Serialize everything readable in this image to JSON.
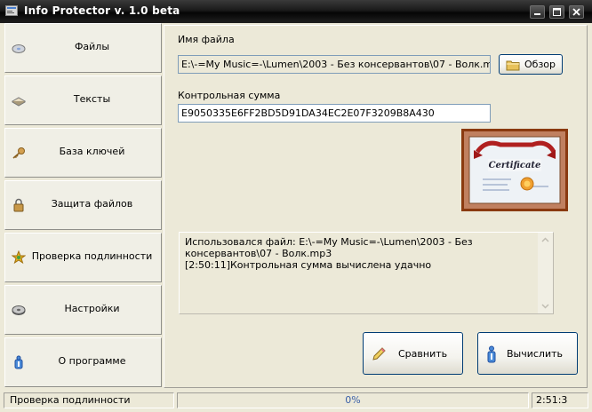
{
  "window": {
    "title": "Info Protector v. 1.0 beta"
  },
  "sidebar": {
    "items": [
      {
        "label": "Файлы",
        "icon": "disk-icon"
      },
      {
        "label": "Тексты",
        "icon": "document-icon"
      },
      {
        "label": "База ключей",
        "icon": "key-icon"
      },
      {
        "label": "Защита файлов",
        "icon": "lock-icon"
      },
      {
        "label": "Проверка подлинности",
        "icon": "authenticity-icon"
      },
      {
        "label": "Настройки",
        "icon": "settings-disk-icon"
      },
      {
        "label": "О программе",
        "icon": "info-icon"
      }
    ]
  },
  "main": {
    "filename_label": "Имя файла",
    "filename_value": "E:\\-=My Music=-\\Lumen\\2003 - Без консервантов\\07 - Волк.mp3",
    "browse_label": "Обзор",
    "checksum_label": "Контрольная сумма",
    "checksum_value": "E9050335E6FF2BD5D91DA34EC2E07F3209B8A430",
    "certificate_text": "Certificate",
    "log": [
      "Использовался файл: E:\\-=My Music=-\\Lumen\\2003 - Без консервантов\\07 - Волк.mp3",
      "[2:50:11]Контрольная сумма вычислена удачно"
    ],
    "compare_label": "Сравнить",
    "compute_label": "Вычислить"
  },
  "status": {
    "mode": "Проверка подлинности",
    "progress": "0%",
    "progress_fraction": 0,
    "time": "2:51:3"
  },
  "colors": {
    "titlebar": "#1a1a1a",
    "face": "#ece9d8",
    "field_border": "#7f9db9",
    "button_border": "#003c74"
  }
}
